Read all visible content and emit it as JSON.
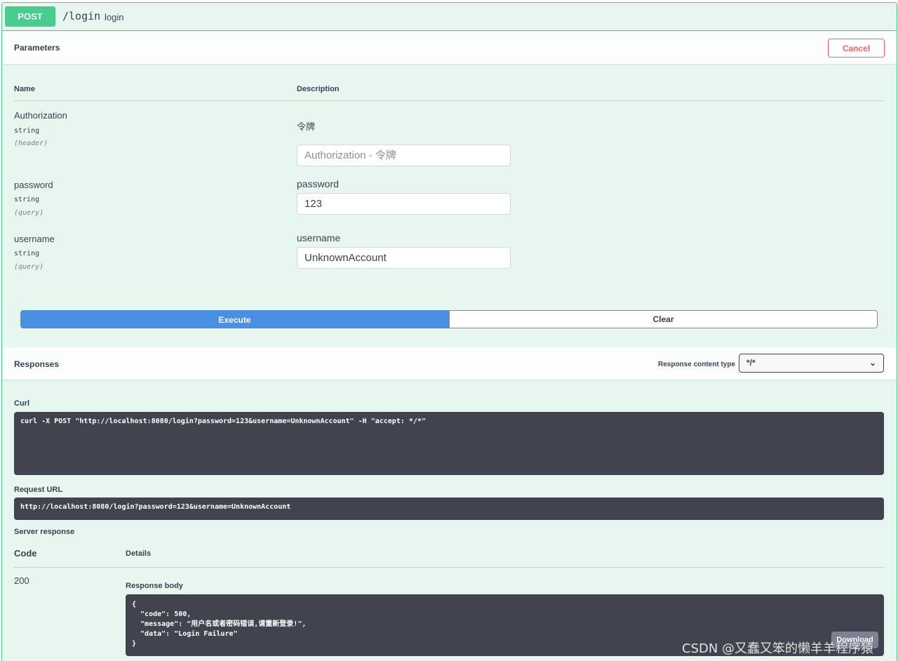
{
  "operation": {
    "method": "POST",
    "path": "/login",
    "summary": "login"
  },
  "parameters": {
    "title": "Parameters",
    "cancel_label": "Cancel",
    "col_name": "Name",
    "col_description": "Description",
    "items": [
      {
        "name": "Authorization",
        "type": "string",
        "in": "(header)",
        "description": "令牌",
        "value": "",
        "placeholder": "Authorization - 令牌"
      },
      {
        "name": "password",
        "type": "string",
        "in": "(query)",
        "description": "password",
        "value": "123",
        "placeholder": ""
      },
      {
        "name": "username",
        "type": "string",
        "in": "(query)",
        "description": "username",
        "value": "UnknownAccount",
        "placeholder": ""
      }
    ]
  },
  "actions": {
    "execute_label": "Execute",
    "clear_label": "Clear"
  },
  "responses": {
    "title": "Responses",
    "content_type_label": "Response content type",
    "content_type_value": "*/*",
    "curl_label": "Curl",
    "curl": "curl -X POST \"http://localhost:8080/login?password=123&username=UnknownAccount\" -H \"accept: */*\"",
    "request_url_label": "Request URL",
    "request_url": "http://localhost:8080/login?password=123&username=UnknownAccount",
    "server_response_label": "Server response",
    "code_header": "Code",
    "details_header": "Details",
    "code": "200",
    "body_label": "Response body",
    "body": "{\n  \"code\": 500,\n  \"message\": \"用户名或者密码错误,请重新登录!\",\n  \"data\": \"Login Failure\"\n}",
    "download_label": "Download"
  },
  "watermark": "CSDN @又蠢又笨的懒羊羊程序猿"
}
